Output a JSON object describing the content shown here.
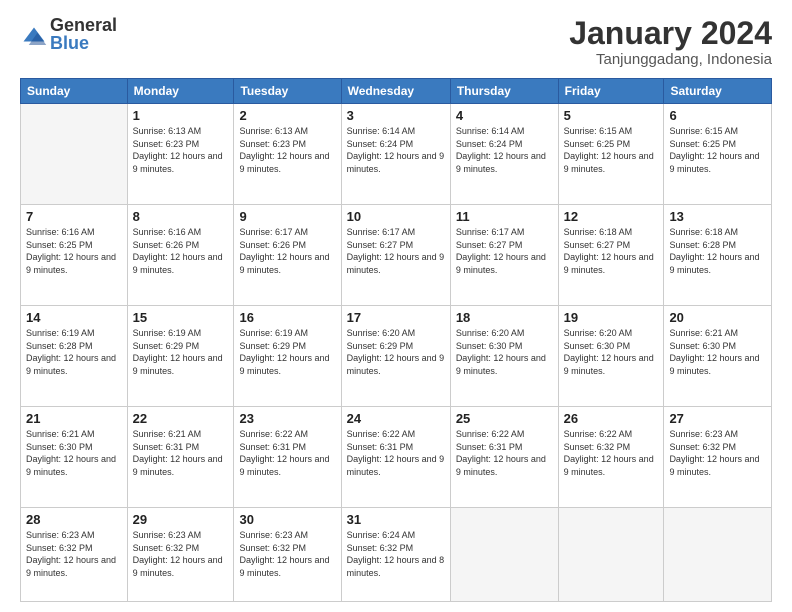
{
  "logo": {
    "general": "General",
    "blue": "Blue"
  },
  "title": "January 2024",
  "location": "Tanjunggadang, Indonesia",
  "days_of_week": [
    "Sunday",
    "Monday",
    "Tuesday",
    "Wednesday",
    "Thursday",
    "Friday",
    "Saturday"
  ],
  "weeks": [
    [
      {
        "day": "",
        "info": ""
      },
      {
        "day": "1",
        "info": "Sunrise: 6:13 AM\nSunset: 6:23 PM\nDaylight: 12 hours and 9 minutes."
      },
      {
        "day": "2",
        "info": "Sunrise: 6:13 AM\nSunset: 6:23 PM\nDaylight: 12 hours and 9 minutes."
      },
      {
        "day": "3",
        "info": "Sunrise: 6:14 AM\nSunset: 6:24 PM\nDaylight: 12 hours and 9 minutes."
      },
      {
        "day": "4",
        "info": "Sunrise: 6:14 AM\nSunset: 6:24 PM\nDaylight: 12 hours and 9 minutes."
      },
      {
        "day": "5",
        "info": "Sunrise: 6:15 AM\nSunset: 6:25 PM\nDaylight: 12 hours and 9 minutes."
      },
      {
        "day": "6",
        "info": "Sunrise: 6:15 AM\nSunset: 6:25 PM\nDaylight: 12 hours and 9 minutes."
      }
    ],
    [
      {
        "day": "7",
        "info": "Sunrise: 6:16 AM\nSunset: 6:25 PM\nDaylight: 12 hours and 9 minutes."
      },
      {
        "day": "8",
        "info": "Sunrise: 6:16 AM\nSunset: 6:26 PM\nDaylight: 12 hours and 9 minutes."
      },
      {
        "day": "9",
        "info": "Sunrise: 6:17 AM\nSunset: 6:26 PM\nDaylight: 12 hours and 9 minutes."
      },
      {
        "day": "10",
        "info": "Sunrise: 6:17 AM\nSunset: 6:27 PM\nDaylight: 12 hours and 9 minutes."
      },
      {
        "day": "11",
        "info": "Sunrise: 6:17 AM\nSunset: 6:27 PM\nDaylight: 12 hours and 9 minutes."
      },
      {
        "day": "12",
        "info": "Sunrise: 6:18 AM\nSunset: 6:27 PM\nDaylight: 12 hours and 9 minutes."
      },
      {
        "day": "13",
        "info": "Sunrise: 6:18 AM\nSunset: 6:28 PM\nDaylight: 12 hours and 9 minutes."
      }
    ],
    [
      {
        "day": "14",
        "info": "Sunrise: 6:19 AM\nSunset: 6:28 PM\nDaylight: 12 hours and 9 minutes."
      },
      {
        "day": "15",
        "info": "Sunrise: 6:19 AM\nSunset: 6:29 PM\nDaylight: 12 hours and 9 minutes."
      },
      {
        "day": "16",
        "info": "Sunrise: 6:19 AM\nSunset: 6:29 PM\nDaylight: 12 hours and 9 minutes."
      },
      {
        "day": "17",
        "info": "Sunrise: 6:20 AM\nSunset: 6:29 PM\nDaylight: 12 hours and 9 minutes."
      },
      {
        "day": "18",
        "info": "Sunrise: 6:20 AM\nSunset: 6:30 PM\nDaylight: 12 hours and 9 minutes."
      },
      {
        "day": "19",
        "info": "Sunrise: 6:20 AM\nSunset: 6:30 PM\nDaylight: 12 hours and 9 minutes."
      },
      {
        "day": "20",
        "info": "Sunrise: 6:21 AM\nSunset: 6:30 PM\nDaylight: 12 hours and 9 minutes."
      }
    ],
    [
      {
        "day": "21",
        "info": "Sunrise: 6:21 AM\nSunset: 6:30 PM\nDaylight: 12 hours and 9 minutes."
      },
      {
        "day": "22",
        "info": "Sunrise: 6:21 AM\nSunset: 6:31 PM\nDaylight: 12 hours and 9 minutes."
      },
      {
        "day": "23",
        "info": "Sunrise: 6:22 AM\nSunset: 6:31 PM\nDaylight: 12 hours and 9 minutes."
      },
      {
        "day": "24",
        "info": "Sunrise: 6:22 AM\nSunset: 6:31 PM\nDaylight: 12 hours and 9 minutes."
      },
      {
        "day": "25",
        "info": "Sunrise: 6:22 AM\nSunset: 6:31 PM\nDaylight: 12 hours and 9 minutes."
      },
      {
        "day": "26",
        "info": "Sunrise: 6:22 AM\nSunset: 6:32 PM\nDaylight: 12 hours and 9 minutes."
      },
      {
        "day": "27",
        "info": "Sunrise: 6:23 AM\nSunset: 6:32 PM\nDaylight: 12 hours and 9 minutes."
      }
    ],
    [
      {
        "day": "28",
        "info": "Sunrise: 6:23 AM\nSunset: 6:32 PM\nDaylight: 12 hours and 9 minutes."
      },
      {
        "day": "29",
        "info": "Sunrise: 6:23 AM\nSunset: 6:32 PM\nDaylight: 12 hours and 9 minutes."
      },
      {
        "day": "30",
        "info": "Sunrise: 6:23 AM\nSunset: 6:32 PM\nDaylight: 12 hours and 9 minutes."
      },
      {
        "day": "31",
        "info": "Sunrise: 6:24 AM\nSunset: 6:32 PM\nDaylight: 12 hours and 8 minutes."
      },
      {
        "day": "",
        "info": ""
      },
      {
        "day": "",
        "info": ""
      },
      {
        "day": "",
        "info": ""
      }
    ]
  ]
}
